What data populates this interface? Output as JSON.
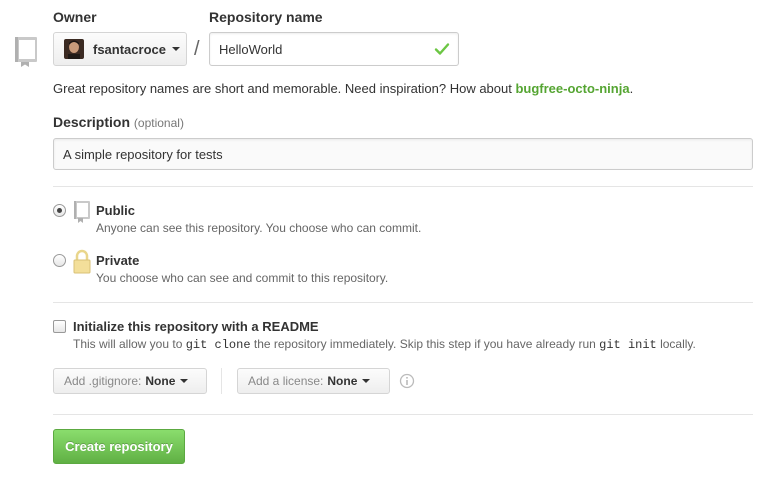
{
  "owner": {
    "label": "Owner",
    "name": "fsantacroce"
  },
  "repository": {
    "label": "Repository name",
    "value": "HelloWorld",
    "separator": "/"
  },
  "hint": {
    "text": "Great repository names are short and memorable. Need inspiration? How about ",
    "suggestion": "bugfree-octo-ninja",
    "end": "."
  },
  "description": {
    "label": "Description",
    "optional": "(optional)",
    "value": "A simple repository for tests"
  },
  "visibility": {
    "public": {
      "title": "Public",
      "desc": "Anyone can see this repository. You choose who can commit.",
      "selected": true
    },
    "private": {
      "title": "Private",
      "desc": "You choose who can see and commit to this repository.",
      "selected": false
    }
  },
  "readme": {
    "title": "Initialize this repository with a README",
    "desc_1": "This will allow you to ",
    "code_1": "git clone",
    "desc_2": " the repository immediately. Skip this step if you have already run ",
    "code_2": "git init",
    "desc_3": " locally.",
    "checked": false
  },
  "gitignore": {
    "label": "Add .gitignore:",
    "value": "None"
  },
  "license": {
    "label": "Add a license:",
    "value": "None"
  },
  "submit": {
    "label": "Create repository"
  },
  "colors": {
    "suggestion_green": "#55a532",
    "button_green": "#60b044",
    "check_green": "#6cc644"
  }
}
